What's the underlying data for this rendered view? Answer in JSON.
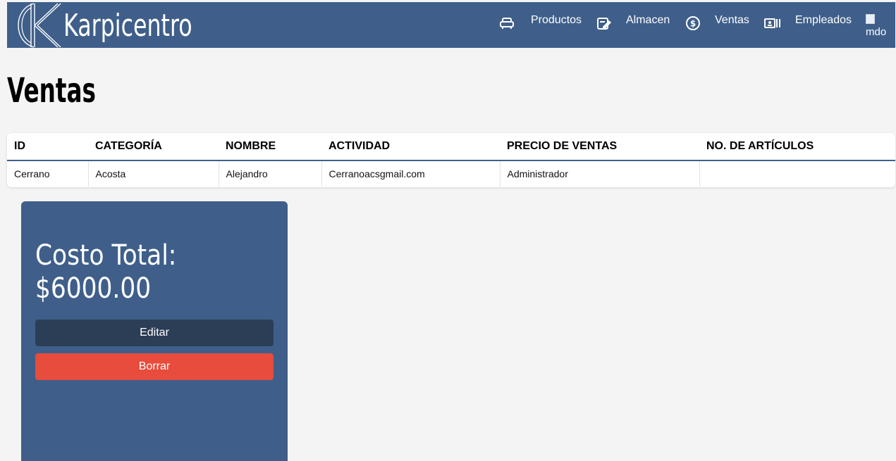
{
  "brand": {
    "name": "Karpicentro"
  },
  "nav": {
    "items": [
      {
        "label": "Productos",
        "icon": "sofa-icon"
      },
      {
        "label": "Almacen",
        "icon": "edit-box-icon"
      },
      {
        "label": "Ventas",
        "icon": "dollar-circle-icon"
      },
      {
        "label": "Empleados",
        "icon": "id-card-icon"
      }
    ],
    "profile_alt": "mdo"
  },
  "page": {
    "title": "Ventas"
  },
  "table": {
    "headers": [
      "ID",
      "CATEGORÍA",
      "NOMBRE",
      "ACTIVIDAD",
      "PRECIO DE VENTAS",
      "NO. DE ARTÍCULOS"
    ],
    "rows": [
      [
        "Cerrano",
        "Acosta",
        "Alejandro",
        "Cerranoacsgmail.com",
        "Administrador",
        ""
      ]
    ]
  },
  "card": {
    "label": "Costo Total:",
    "amount": "$6000.00",
    "edit_label": "Editar",
    "delete_label": "Borrar"
  },
  "colors": {
    "primary": "#3f5f8a",
    "dark": "#2c3e56",
    "danger": "#e74c3c",
    "background": "#f4f4f4"
  }
}
